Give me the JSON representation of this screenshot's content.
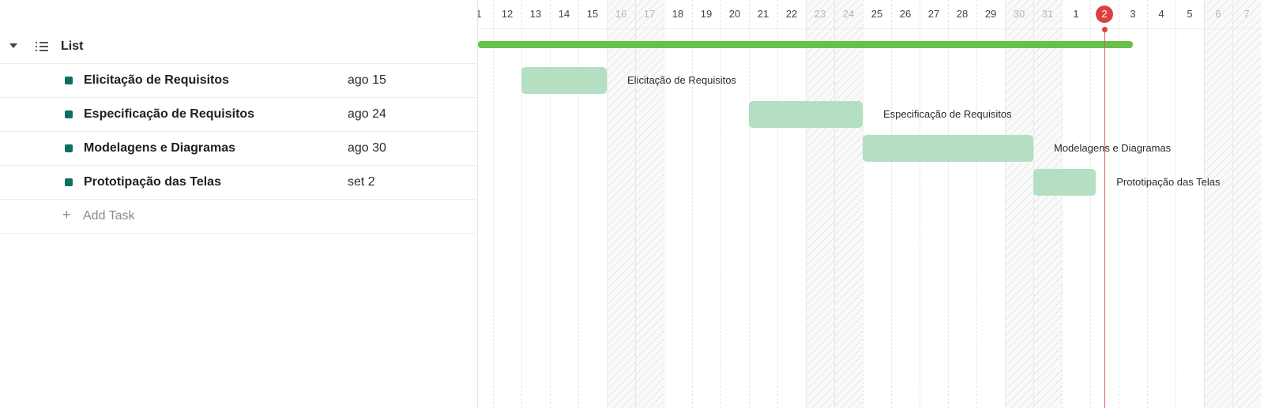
{
  "list": {
    "title": "List",
    "add_task_label": "Add Task"
  },
  "tasks": [
    {
      "name": "Elicitação de Requisitos",
      "due": "ago 15",
      "bar_label": "Elicitação de Requisitos"
    },
    {
      "name": "Especificação de Requisitos",
      "due": "ago 24",
      "bar_label": "Especificação de Requisitos"
    },
    {
      "name": "Modelagens e Diagramas",
      "due": "ago 30",
      "bar_label": "Modelagens e Diagramas"
    },
    {
      "name": "Prototipação das Telas",
      "due": "set 2",
      "bar_label": "Prototipação das Telas"
    }
  ],
  "timeline": {
    "days": [
      {
        "label": "1",
        "weekend": false
      },
      {
        "label": "12",
        "weekend": false
      },
      {
        "label": "13",
        "weekend": false
      },
      {
        "label": "14",
        "weekend": false
      },
      {
        "label": "15",
        "weekend": false
      },
      {
        "label": "16",
        "weekend": true
      },
      {
        "label": "17",
        "weekend": true
      },
      {
        "label": "18",
        "weekend": false
      },
      {
        "label": "19",
        "weekend": false
      },
      {
        "label": "20",
        "weekend": false
      },
      {
        "label": "21",
        "weekend": false
      },
      {
        "label": "22",
        "weekend": false
      },
      {
        "label": "23",
        "weekend": true
      },
      {
        "label": "24",
        "weekend": true
      },
      {
        "label": "25",
        "weekend": false
      },
      {
        "label": "26",
        "weekend": false
      },
      {
        "label": "27",
        "weekend": false
      },
      {
        "label": "28",
        "weekend": false
      },
      {
        "label": "29",
        "weekend": false
      },
      {
        "label": "30",
        "weekend": true
      },
      {
        "label": "31",
        "weekend": true
      },
      {
        "label": "1",
        "weekend": false
      },
      {
        "label": "2",
        "weekend": false,
        "today": true
      },
      {
        "label": "3",
        "weekend": false
      },
      {
        "label": "4",
        "weekend": false
      },
      {
        "label": "5",
        "weekend": false
      },
      {
        "label": "6",
        "weekend": true
      },
      {
        "label": "7",
        "weekend": true
      }
    ],
    "today_index": 22,
    "summary_span": {
      "start_index": 0,
      "end_index": 23.5
    },
    "task_spans": [
      {
        "start_index": 1.5,
        "end_index": 4.5
      },
      {
        "start_index": 9.5,
        "end_index": 13.5
      },
      {
        "start_index": 13.5,
        "end_index": 19.5
      },
      {
        "start_index": 19.5,
        "end_index": 21.7
      }
    ]
  },
  "colors": {
    "task_dot": "#0e6e60",
    "summary_bar": "#66c04a",
    "task_bar": "#b4dfc3",
    "today": "#e03f3f"
  },
  "icons": {
    "collapse": "caret-down-icon",
    "list": "list-icon",
    "add": "plus-icon"
  }
}
